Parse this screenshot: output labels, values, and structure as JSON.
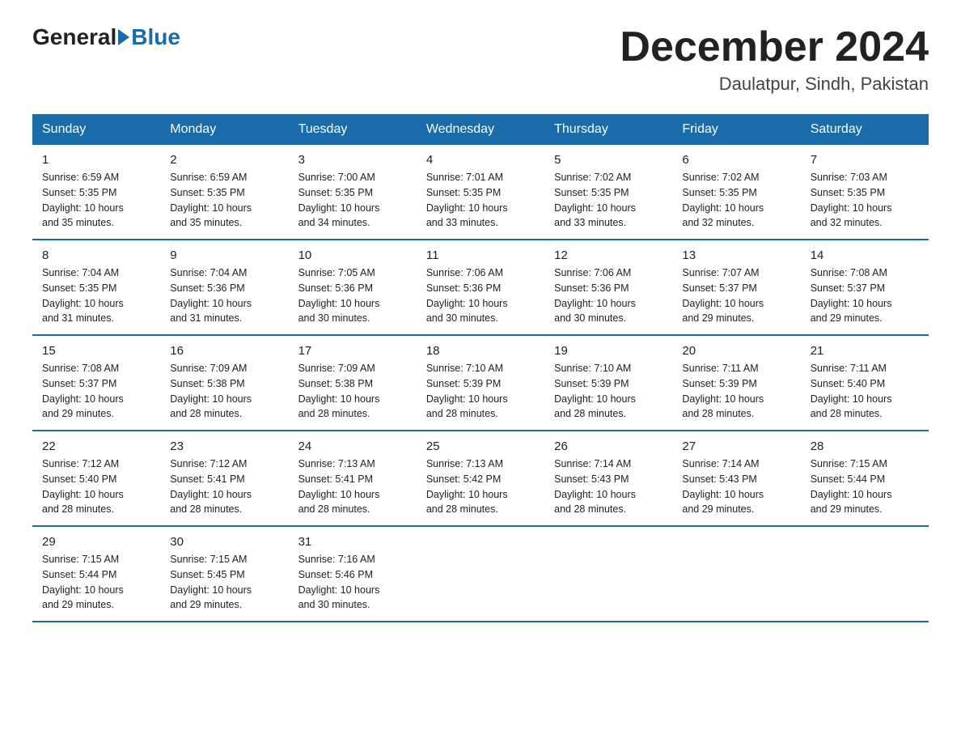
{
  "header": {
    "logo_general": "General",
    "logo_blue": "Blue",
    "month_title": "December 2024",
    "location": "Daulatpur, Sindh, Pakistan"
  },
  "days_of_week": [
    "Sunday",
    "Monday",
    "Tuesday",
    "Wednesday",
    "Thursday",
    "Friday",
    "Saturday"
  ],
  "weeks": [
    [
      {
        "day": 1,
        "sunrise": "6:59 AM",
        "sunset": "5:35 PM",
        "daylight": "10 hours and 35 minutes."
      },
      {
        "day": 2,
        "sunrise": "6:59 AM",
        "sunset": "5:35 PM",
        "daylight": "10 hours and 35 minutes."
      },
      {
        "day": 3,
        "sunrise": "7:00 AM",
        "sunset": "5:35 PM",
        "daylight": "10 hours and 34 minutes."
      },
      {
        "day": 4,
        "sunrise": "7:01 AM",
        "sunset": "5:35 PM",
        "daylight": "10 hours and 33 minutes."
      },
      {
        "day": 5,
        "sunrise": "7:02 AM",
        "sunset": "5:35 PM",
        "daylight": "10 hours and 33 minutes."
      },
      {
        "day": 6,
        "sunrise": "7:02 AM",
        "sunset": "5:35 PM",
        "daylight": "10 hours and 32 minutes."
      },
      {
        "day": 7,
        "sunrise": "7:03 AM",
        "sunset": "5:35 PM",
        "daylight": "10 hours and 32 minutes."
      }
    ],
    [
      {
        "day": 8,
        "sunrise": "7:04 AM",
        "sunset": "5:35 PM",
        "daylight": "10 hours and 31 minutes."
      },
      {
        "day": 9,
        "sunrise": "7:04 AM",
        "sunset": "5:36 PM",
        "daylight": "10 hours and 31 minutes."
      },
      {
        "day": 10,
        "sunrise": "7:05 AM",
        "sunset": "5:36 PM",
        "daylight": "10 hours and 30 minutes."
      },
      {
        "day": 11,
        "sunrise": "7:06 AM",
        "sunset": "5:36 PM",
        "daylight": "10 hours and 30 minutes."
      },
      {
        "day": 12,
        "sunrise": "7:06 AM",
        "sunset": "5:36 PM",
        "daylight": "10 hours and 30 minutes."
      },
      {
        "day": 13,
        "sunrise": "7:07 AM",
        "sunset": "5:37 PM",
        "daylight": "10 hours and 29 minutes."
      },
      {
        "day": 14,
        "sunrise": "7:08 AM",
        "sunset": "5:37 PM",
        "daylight": "10 hours and 29 minutes."
      }
    ],
    [
      {
        "day": 15,
        "sunrise": "7:08 AM",
        "sunset": "5:37 PM",
        "daylight": "10 hours and 29 minutes."
      },
      {
        "day": 16,
        "sunrise": "7:09 AM",
        "sunset": "5:38 PM",
        "daylight": "10 hours and 28 minutes."
      },
      {
        "day": 17,
        "sunrise": "7:09 AM",
        "sunset": "5:38 PM",
        "daylight": "10 hours and 28 minutes."
      },
      {
        "day": 18,
        "sunrise": "7:10 AM",
        "sunset": "5:39 PM",
        "daylight": "10 hours and 28 minutes."
      },
      {
        "day": 19,
        "sunrise": "7:10 AM",
        "sunset": "5:39 PM",
        "daylight": "10 hours and 28 minutes."
      },
      {
        "day": 20,
        "sunrise": "7:11 AM",
        "sunset": "5:39 PM",
        "daylight": "10 hours and 28 minutes."
      },
      {
        "day": 21,
        "sunrise": "7:11 AM",
        "sunset": "5:40 PM",
        "daylight": "10 hours and 28 minutes."
      }
    ],
    [
      {
        "day": 22,
        "sunrise": "7:12 AM",
        "sunset": "5:40 PM",
        "daylight": "10 hours and 28 minutes."
      },
      {
        "day": 23,
        "sunrise": "7:12 AM",
        "sunset": "5:41 PM",
        "daylight": "10 hours and 28 minutes."
      },
      {
        "day": 24,
        "sunrise": "7:13 AM",
        "sunset": "5:41 PM",
        "daylight": "10 hours and 28 minutes."
      },
      {
        "day": 25,
        "sunrise": "7:13 AM",
        "sunset": "5:42 PM",
        "daylight": "10 hours and 28 minutes."
      },
      {
        "day": 26,
        "sunrise": "7:14 AM",
        "sunset": "5:43 PM",
        "daylight": "10 hours and 28 minutes."
      },
      {
        "day": 27,
        "sunrise": "7:14 AM",
        "sunset": "5:43 PM",
        "daylight": "10 hours and 29 minutes."
      },
      {
        "day": 28,
        "sunrise": "7:15 AM",
        "sunset": "5:44 PM",
        "daylight": "10 hours and 29 minutes."
      }
    ],
    [
      {
        "day": 29,
        "sunrise": "7:15 AM",
        "sunset": "5:44 PM",
        "daylight": "10 hours and 29 minutes."
      },
      {
        "day": 30,
        "sunrise": "7:15 AM",
        "sunset": "5:45 PM",
        "daylight": "10 hours and 29 minutes."
      },
      {
        "day": 31,
        "sunrise": "7:16 AM",
        "sunset": "5:46 PM",
        "daylight": "10 hours and 30 minutes."
      },
      null,
      null,
      null,
      null
    ]
  ],
  "labels": {
    "sunrise": "Sunrise:",
    "sunset": "Sunset:",
    "daylight": "Daylight:"
  }
}
